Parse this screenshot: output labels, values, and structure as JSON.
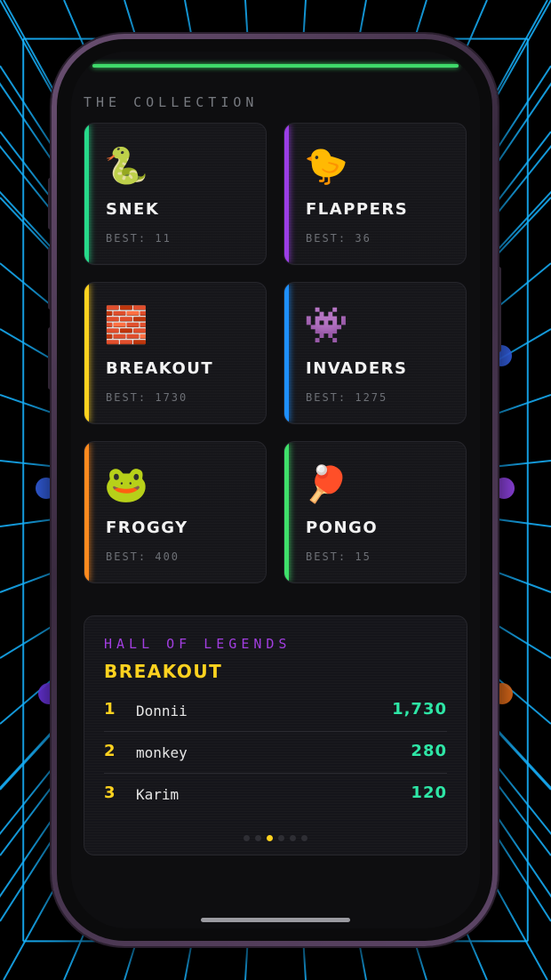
{
  "collection_title": "THE COLLECTION",
  "games": [
    {
      "emoji": "🐍",
      "name": "SNEK",
      "best": "BEST: 11",
      "accent": "#27d98a"
    },
    {
      "emoji": "🐤",
      "name": "FLAPPERS",
      "best": "BEST: 36",
      "accent": "#9b3ee6"
    },
    {
      "emoji": "🧱",
      "name": "BREAKOUT",
      "best": "BEST: 1730",
      "accent": "#ffd21f"
    },
    {
      "emoji": "👾",
      "name": "INVADERS",
      "best": "BEST: 1275",
      "accent": "#1e90ff"
    },
    {
      "emoji": "🐸",
      "name": "FROGGY",
      "best": "BEST: 400",
      "accent": "#ff8a1e"
    },
    {
      "emoji": "🏓",
      "name": "PONGO",
      "best": "BEST: 15",
      "accent": "#3fe06a"
    }
  ],
  "legends": {
    "heading": "HALL OF LEGENDS",
    "game": "BREAKOUT",
    "entries": [
      {
        "rank": "1",
        "name": "Donnii",
        "score": "1,730"
      },
      {
        "rank": "2",
        "name": "monkey",
        "score": "280"
      },
      {
        "rank": "3",
        "name": "Karim",
        "score": "120"
      }
    ],
    "pager_total": 6,
    "pager_active": 2
  },
  "colors": {
    "grid": "#18b4ff",
    "top_bar": "#3fd96a",
    "gold": "#ffd21f",
    "score": "#2ee6a6",
    "legend_heading": "#a23ee0"
  }
}
